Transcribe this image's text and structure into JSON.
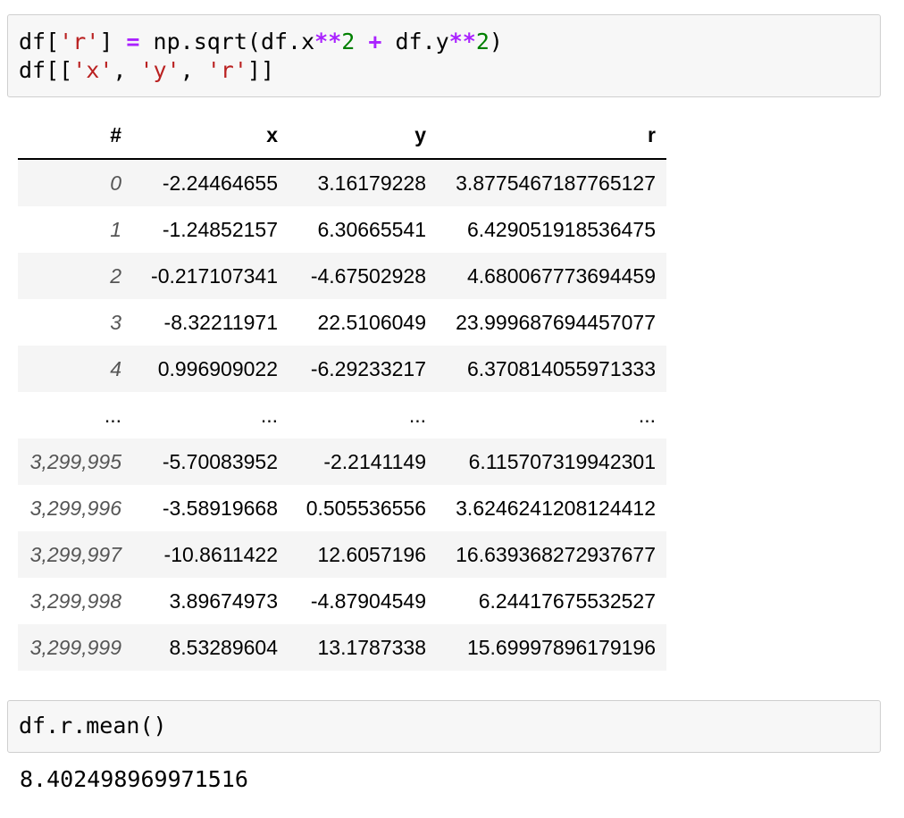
{
  "cell1": {
    "line1": [
      {
        "t": "df[",
        "c": "plain"
      },
      {
        "t": "'r'",
        "c": "str"
      },
      {
        "t": "] ",
        "c": "plain"
      },
      {
        "t": "=",
        "c": "op"
      },
      {
        "t": " np.sqrt(df.x",
        "c": "plain"
      },
      {
        "t": "**",
        "c": "op"
      },
      {
        "t": "2",
        "c": "num"
      },
      {
        "t": " ",
        "c": "plain"
      },
      {
        "t": "+",
        "c": "op"
      },
      {
        "t": " df.y",
        "c": "plain"
      },
      {
        "t": "**",
        "c": "op"
      },
      {
        "t": "2",
        "c": "num"
      },
      {
        "t": ")",
        "c": "plain"
      }
    ],
    "line2": [
      {
        "t": "df[[",
        "c": "plain"
      },
      {
        "t": "'x'",
        "c": "str"
      },
      {
        "t": ", ",
        "c": "plain"
      },
      {
        "t": "'y'",
        "c": "str"
      },
      {
        "t": ", ",
        "c": "plain"
      },
      {
        "t": "'r'",
        "c": "str"
      },
      {
        "t": "]]",
        "c": "plain"
      }
    ]
  },
  "table": {
    "headers": [
      "#",
      "x",
      "y",
      "r"
    ],
    "rows": [
      {
        "idx": "0",
        "x": "-2.24464655",
        "y": "3.16179228",
        "r": "3.8775467187765127"
      },
      {
        "idx": "1",
        "x": "-1.24852157",
        "y": "6.30665541",
        "r": "6.429051918536475"
      },
      {
        "idx": "2",
        "x": "-0.217107341",
        "y": "-4.67502928",
        "r": "4.680067773694459"
      },
      {
        "idx": "3",
        "x": "-8.32211971",
        "y": "22.5106049",
        "r": "23.999687694457077"
      },
      {
        "idx": "4",
        "x": "0.996909022",
        "y": "-6.29233217",
        "r": "6.370814055971333"
      },
      {
        "idx": "...",
        "x": "...",
        "y": "...",
        "r": "...",
        "ellipsis": true
      },
      {
        "idx": "3,299,995",
        "x": "-5.70083952",
        "y": "-2.2141149",
        "r": "6.115707319942301"
      },
      {
        "idx": "3,299,996",
        "x": "-3.58919668",
        "y": "0.505536556",
        "r": "3.6246241208124412"
      },
      {
        "idx": "3,299,997",
        "x": "-10.8611422",
        "y": "12.6057196",
        "r": "16.639368272937677"
      },
      {
        "idx": "3,299,998",
        "x": "3.89674973",
        "y": "-4.87904549",
        "r": "6.24417675532527"
      },
      {
        "idx": "3,299,999",
        "x": "8.53289604",
        "y": "13.1787338",
        "r": "15.69997896179196"
      }
    ]
  },
  "cell2": {
    "code": "df.r.mean()"
  },
  "output": {
    "value": "8.402498969971516"
  }
}
